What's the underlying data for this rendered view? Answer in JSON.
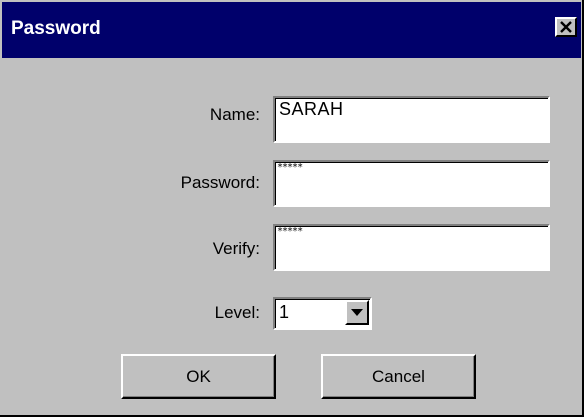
{
  "window": {
    "title": "Password",
    "close_glyph": "×",
    "colors": {
      "titlebar": "#00006b",
      "face": "#c0c0c0"
    }
  },
  "form": {
    "name": {
      "label": "Name:",
      "value": "SARAH"
    },
    "password": {
      "label": "Password:",
      "value": "*****"
    },
    "verify": {
      "label": "Verify:",
      "value": "*****"
    },
    "level": {
      "label": "Level:",
      "value": "1",
      "icon": "chevron-down-icon"
    }
  },
  "buttons": {
    "ok": "OK",
    "cancel": "Cancel"
  }
}
